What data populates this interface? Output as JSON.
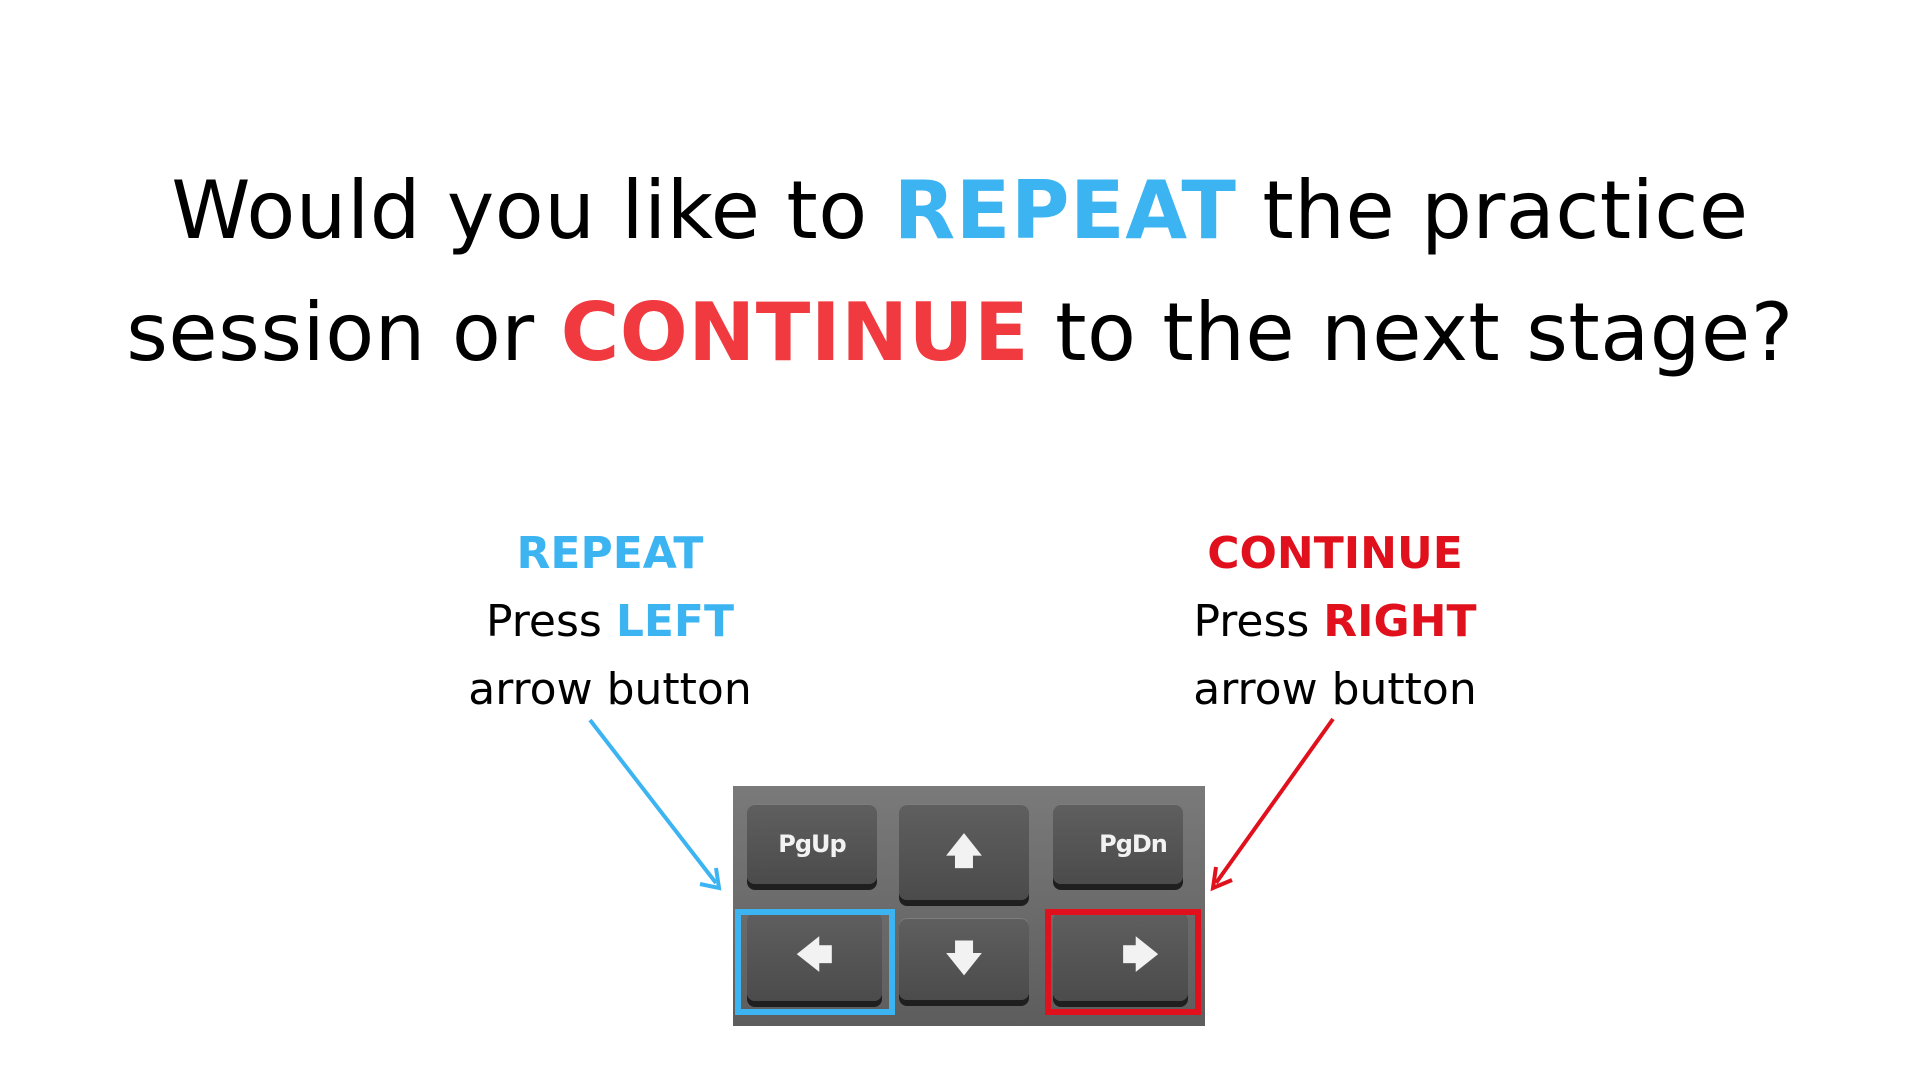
{
  "question": {
    "line1_pre": "Would you like to ",
    "repeat_word": "REPEAT",
    "line1_post": " the practice",
    "line2_pre": "session or ",
    "continue_word": "CONTINUE",
    "line2_post": " to the next stage?"
  },
  "left_option": {
    "heading": "REPEAT",
    "press": "Press ",
    "key_word": "LEFT",
    "suffix": "arrow button"
  },
  "right_option": {
    "heading": "CONTINUE",
    "press": "Press ",
    "key_word": "RIGHT",
    "suffix": "arrow button"
  },
  "keypad": {
    "pgup": "PgUp",
    "pgdn": "PgDn",
    "up_glyph": "🡅",
    "down_glyph": "🡇",
    "left_glyph": "🡄",
    "right_glyph": "🡆",
    "icons": [
      "arrow-up-icon",
      "arrow-down-icon",
      "arrow-left-icon",
      "arrow-right-icon"
    ]
  },
  "colors": {
    "repeat": "#3db4f2",
    "continue": "#f03a3f",
    "continue_label": "#e0101c",
    "keypad_bg": "#6e6e6e",
    "key": "#4f4f4f"
  }
}
